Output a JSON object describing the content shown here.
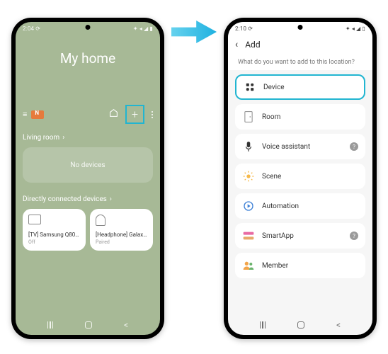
{
  "colors": {
    "highlight": "#21b5d1",
    "orange": "#e67a3c",
    "green": "#a7b996"
  },
  "left": {
    "status": {
      "time": "2:04",
      "ampm": "⏱"
    },
    "title": "My home",
    "section1": "Living room",
    "no_devices": "No devices",
    "section2": "Directly connected devices",
    "device1": {
      "name": "[TV] Samsung Q800 …",
      "sub": "Off"
    },
    "device2": {
      "name": "[Headphone] Galaxy …",
      "sub": "Paired"
    }
  },
  "right": {
    "status": {
      "time": "2:10",
      "ampm": "⏱"
    },
    "header": "Add",
    "subhead": "What do you want to add to this location?",
    "items": [
      {
        "label": "Device",
        "highlight": true
      },
      {
        "label": "Room"
      },
      {
        "label": "Voice assistant",
        "help": true
      },
      {
        "label": "Scene"
      },
      {
        "label": "Automation"
      },
      {
        "label": "SmartApp",
        "help": true
      },
      {
        "label": "Member"
      }
    ]
  }
}
